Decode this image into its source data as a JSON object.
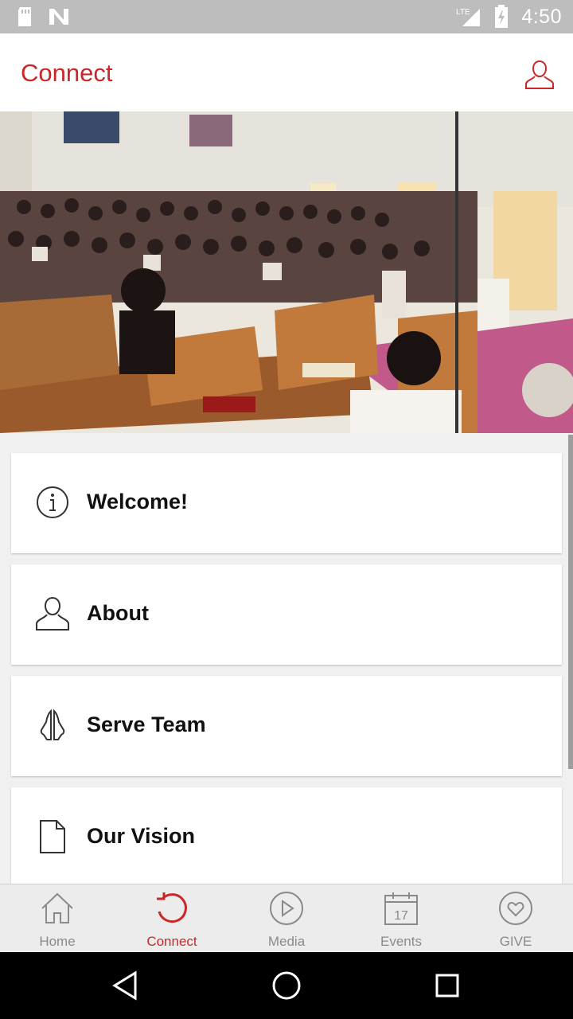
{
  "status_bar": {
    "time": "4:50",
    "network": "LTE"
  },
  "app_bar": {
    "title": "Connect"
  },
  "menu": {
    "items": [
      {
        "label": "Welcome!",
        "icon": "info-icon"
      },
      {
        "label": "About",
        "icon": "person-icon"
      },
      {
        "label": "Serve Team",
        "icon": "praying-hands-icon"
      },
      {
        "label": "Our Vision",
        "icon": "document-icon"
      }
    ]
  },
  "tabs": [
    {
      "label": "Home",
      "icon": "home-icon",
      "active": false
    },
    {
      "label": "Connect",
      "icon": "connect-icon",
      "active": true
    },
    {
      "label": "Media",
      "icon": "play-icon",
      "active": false
    },
    {
      "label": "Events",
      "icon": "calendar-icon",
      "active": false,
      "calendar_day": "17"
    },
    {
      "label": "GIVE",
      "icon": "heart-icon",
      "active": false
    }
  ],
  "colors": {
    "accent": "#c8282a",
    "inactive": "#8a8a8a"
  }
}
